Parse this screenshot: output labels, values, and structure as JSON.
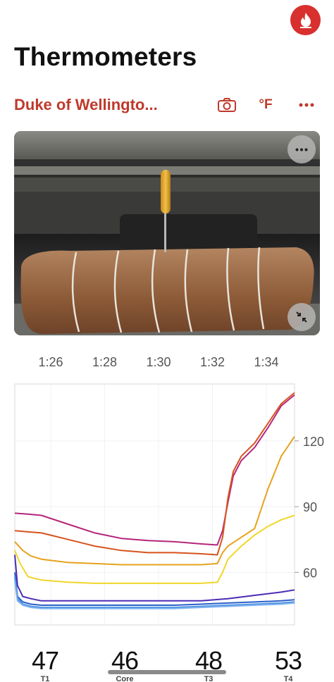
{
  "header": {
    "title": "Thermometers",
    "logo_icon": "fire-icon",
    "accent_color": "#d8302f"
  },
  "toolbar": {
    "cook_name": "Duke of Wellingto...",
    "camera_icon": "camera-icon",
    "unit_label": "°F",
    "more_icon": "more-horizontal-icon"
  },
  "photo": {
    "menu_icon": "more-horizontal-icon",
    "collapse_icon": "collapse-arrows-icon"
  },
  "chart_data": {
    "type": "line",
    "x_ticks": [
      "1:26",
      "1:28",
      "1:30",
      "1:32",
      "1:34"
    ],
    "y_ticks": [
      60,
      90,
      120
    ],
    "ylabel": "",
    "xlabel": "",
    "title": "",
    "ylim": [
      36,
      146
    ],
    "xlim": [
      0,
      10.5
    ],
    "grid": true,
    "y_axis_position": "right",
    "series": [
      {
        "color": "#b5267a",
        "x": [
          0,
          0.5,
          1,
          2,
          3,
          4,
          5,
          6,
          7,
          7.6,
          7.8,
          8,
          8.2,
          8.5,
          9,
          9.5,
          10,
          10.5
        ],
        "y": [
          87,
          86.6,
          86,
          82,
          78,
          75.5,
          74.5,
          74,
          73,
          72.5,
          79,
          92,
          104,
          111,
          117,
          126,
          136,
          141
        ]
      },
      {
        "color": "#d6531f",
        "x": [
          0,
          0.5,
          1,
          2,
          3,
          4,
          5,
          6,
          7,
          7.6,
          7.8,
          8,
          8.2,
          8.5,
          9,
          9.5,
          10,
          10.5
        ],
        "y": [
          79,
          78.5,
          78,
          75,
          72,
          70,
          69,
          69,
          68.5,
          68,
          76,
          94,
          106,
          113,
          119,
          128,
          137,
          142
        ]
      },
      {
        "color": "#e6a21e",
        "x": [
          0,
          0.3,
          0.6,
          1,
          2,
          3,
          4,
          5,
          6,
          7,
          7.6,
          7.8,
          8,
          8.5,
          9,
          9.5,
          10,
          10.5
        ],
        "y": [
          74,
          70,
          67.5,
          66,
          64.5,
          64,
          63.5,
          63.5,
          63.5,
          63.5,
          64,
          69,
          72,
          76,
          80,
          98,
          113,
          122
        ]
      },
      {
        "color": "#f1d62a",
        "x": [
          0,
          0.2,
          0.5,
          1,
          2,
          3,
          4,
          5,
          6,
          7,
          7.6,
          7.8,
          8,
          8.5,
          9,
          9.5,
          10,
          10.5
        ],
        "y": [
          70,
          64,
          58,
          56.5,
          55.5,
          55,
          55,
          55,
          55,
          55,
          55.5,
          60,
          66,
          72,
          77,
          81,
          84,
          86
        ]
      },
      {
        "color": "#4b2bb5",
        "x": [
          0,
          0.1,
          0.3,
          0.6,
          1,
          2,
          3,
          4,
          5,
          6,
          7,
          8,
          9,
          10,
          10.5
        ],
        "y": [
          68,
          54,
          49,
          48,
          47,
          47,
          47,
          47,
          47,
          47,
          47,
          48,
          49.5,
          51,
          52
        ]
      },
      {
        "color": "#2a5fc9",
        "x": [
          0,
          0.1,
          0.3,
          0.6,
          1,
          2,
          3,
          4,
          5,
          6,
          7,
          8,
          9,
          10,
          10.5
        ],
        "y": [
          60,
          49,
          46.5,
          45.5,
          45,
          45,
          45,
          45,
          45,
          45,
          45.5,
          46,
          46.5,
          47,
          47.5
        ]
      },
      {
        "color": "#4a8fe0",
        "x": [
          0,
          0.1,
          0.3,
          0.6,
          1,
          2,
          3,
          4,
          5,
          6,
          7,
          8,
          9,
          10,
          10.5
        ],
        "y": [
          58,
          48,
          45.5,
          44.5,
          44,
          44,
          44,
          44,
          44,
          44,
          44.5,
          45,
          45.5,
          46,
          46.5
        ]
      },
      {
        "color": "#7fb3ef",
        "x": [
          0,
          0.1,
          0.3,
          0.6,
          1,
          2,
          3,
          4,
          5,
          6,
          7,
          8,
          9,
          10,
          10.5
        ],
        "y": [
          56,
          47,
          45,
          44,
          43.5,
          43.5,
          43.5,
          43.5,
          43.5,
          43.5,
          44,
          44.5,
          45,
          45.5,
          46
        ]
      }
    ]
  },
  "readings": [
    {
      "value": "47",
      "label": "T1"
    },
    {
      "value": "46",
      "label": "Core"
    },
    {
      "value": "48",
      "label": "T3"
    },
    {
      "value": "53",
      "label": "T4"
    }
  ]
}
